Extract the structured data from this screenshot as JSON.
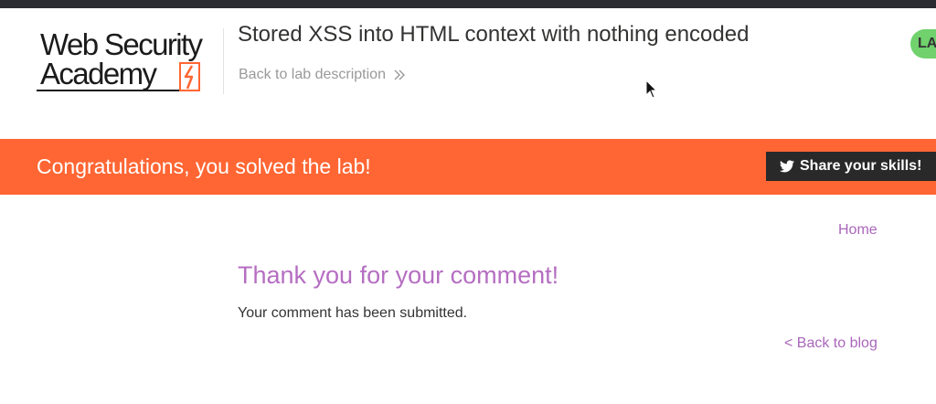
{
  "header": {
    "logo": {
      "line1": "Web Security",
      "line2": "Academy"
    },
    "lab_title": "Stored XSS into HTML context with nothing encoded",
    "back_to_description": "Back to lab description",
    "status_label": "LAB Solved",
    "status_color": "#70d16d"
  },
  "banner": {
    "message": "Congratulations, you solved the lab!",
    "share_label": "Share your skills!",
    "color": "#ff6633"
  },
  "nav": {
    "home": "Home"
  },
  "main": {
    "heading": "Thank you for your comment!",
    "message": "Your comment has been submitted.",
    "back_link": "< Back to blog"
  },
  "icons": [
    "lightning-logo-icon",
    "double-chevron-right-icon",
    "twitter-bird-icon",
    "mouse-cursor-icon"
  ]
}
